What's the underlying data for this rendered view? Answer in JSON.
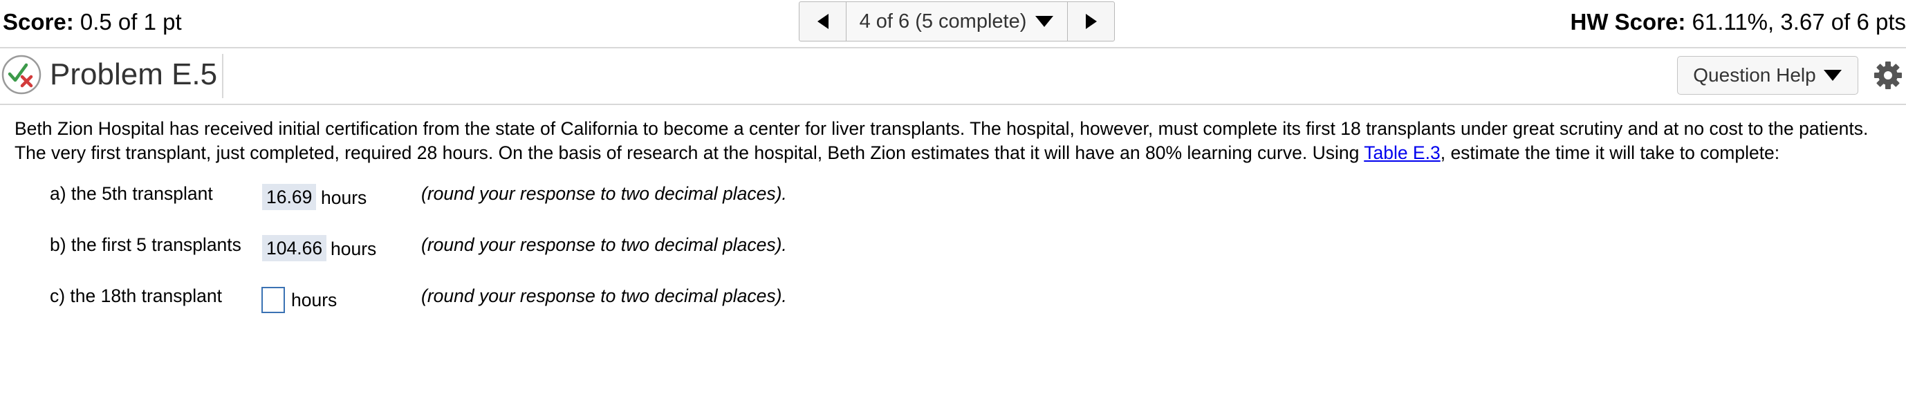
{
  "header": {
    "score_label": "Score:",
    "score_value": "0.5 of 1 pt",
    "hw_label": "HW Score:",
    "hw_value": "61.11%, 3.67 of 6 pts",
    "pager_text": "4 of 6 (5 complete)"
  },
  "problem": {
    "title": "Problem E.5",
    "help_label": "Question Help",
    "status_icon": "partial-credit-check-x-icon"
  },
  "question": {
    "text_before": "Beth Zion Hospital has received initial certification from the state of California to become a center for liver transplants.  The hospital, however, must complete its first 18 transplants under great scrutiny and at no cost to the patients.  The very first transplant, just completed, required 28 hours. On the basis of research at the hospital, Beth Zion estimates that it will have an 80% learning curve. Using ",
    "link_text": "Table E.3",
    "text_after": ", estimate the time it will take to complete:"
  },
  "parts": [
    {
      "label": "a) the 5th transplant",
      "value": "16.69",
      "units": "hours",
      "hint": "(round your response to two decimal places)."
    },
    {
      "label": "b) the first 5 transplants",
      "value": "104.66",
      "units": "hours",
      "hint": "(round your response to two decimal places)."
    },
    {
      "label": "c) the 18th transplant",
      "value": "",
      "units": "hours",
      "hint": "(round your response to two decimal places)."
    }
  ],
  "colors": {
    "answer_fill": "#e0e6ef",
    "input_border": "#3a72b3",
    "link": "#0000ee",
    "status_check": "#3c9a4a",
    "status_x": "#d23b3b"
  }
}
